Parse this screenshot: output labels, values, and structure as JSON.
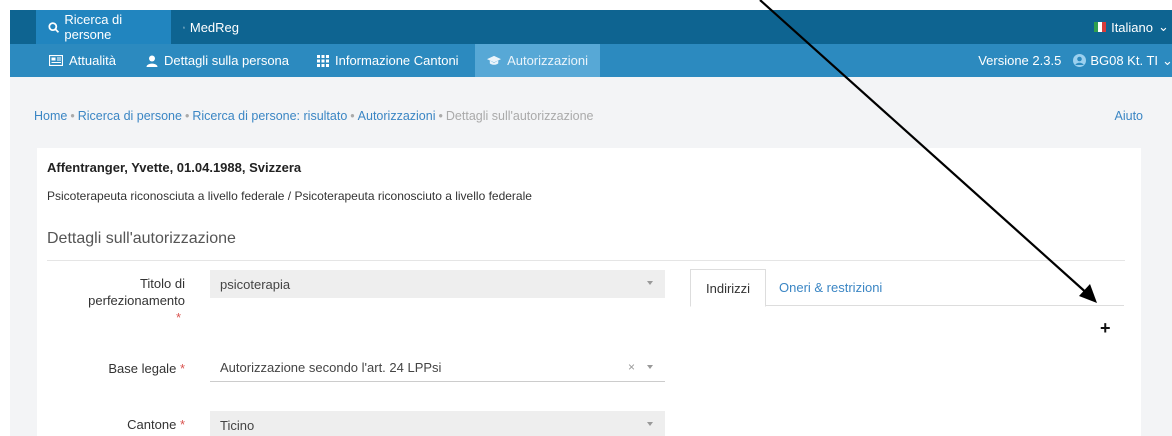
{
  "topbar": {
    "tabs": [
      {
        "label": "Ricerca di persone",
        "icon": "search-icon"
      },
      {
        "label": "MedReg",
        "icon": "sitemap-icon"
      }
    ],
    "language": "Italiano"
  },
  "subbar": {
    "tabs": [
      {
        "label": "Attualità",
        "icon": "newspaper-icon"
      },
      {
        "label": "Dettagli sulla persona",
        "icon": "user-icon"
      },
      {
        "label": "Informazione Cantoni",
        "icon": "grid-icon"
      },
      {
        "label": "Autorizzazioni",
        "icon": "graduation-cap-icon"
      }
    ],
    "version": "Versione 2.3.5",
    "user": "BG08 Kt. TI"
  },
  "breadcrumb": {
    "items": [
      "Home",
      "Ricerca di persone",
      "Ricerca di persone: risultato",
      "Autorizzazioni"
    ],
    "current": "Dettagli sull'autorizzazione",
    "separator": "•"
  },
  "help": "Aiuto",
  "card": {
    "person": "Affentranger, Yvette, 01.04.1988, Svizzera",
    "description": "Psicoterapeuta riconosciuta a livello federale / Psicoterapeuta riconosciuto a livello federale",
    "section_title": "Dettagli sull'autorizzazione"
  },
  "form": {
    "titolo": {
      "label_line1": "Titolo di",
      "label_line2": "perfezionamento",
      "value": "psicoterapia"
    },
    "base": {
      "label": "Base legale",
      "value": "Autorizzazione secondo l'art. 24 LPPsi"
    },
    "cantone": {
      "label": "Cantone",
      "value": "Ticino"
    },
    "required_mark": "*"
  },
  "tabs": {
    "indirizzi": "Indirizzi",
    "oneri": "Oneri & restrizioni"
  },
  "add_symbol": "+",
  "colors": {
    "topbar": "#0e6491",
    "subbar": "#2c8abf",
    "active_tab": "#2185bf",
    "link": "#3b86c4",
    "required": "#d9534f"
  }
}
